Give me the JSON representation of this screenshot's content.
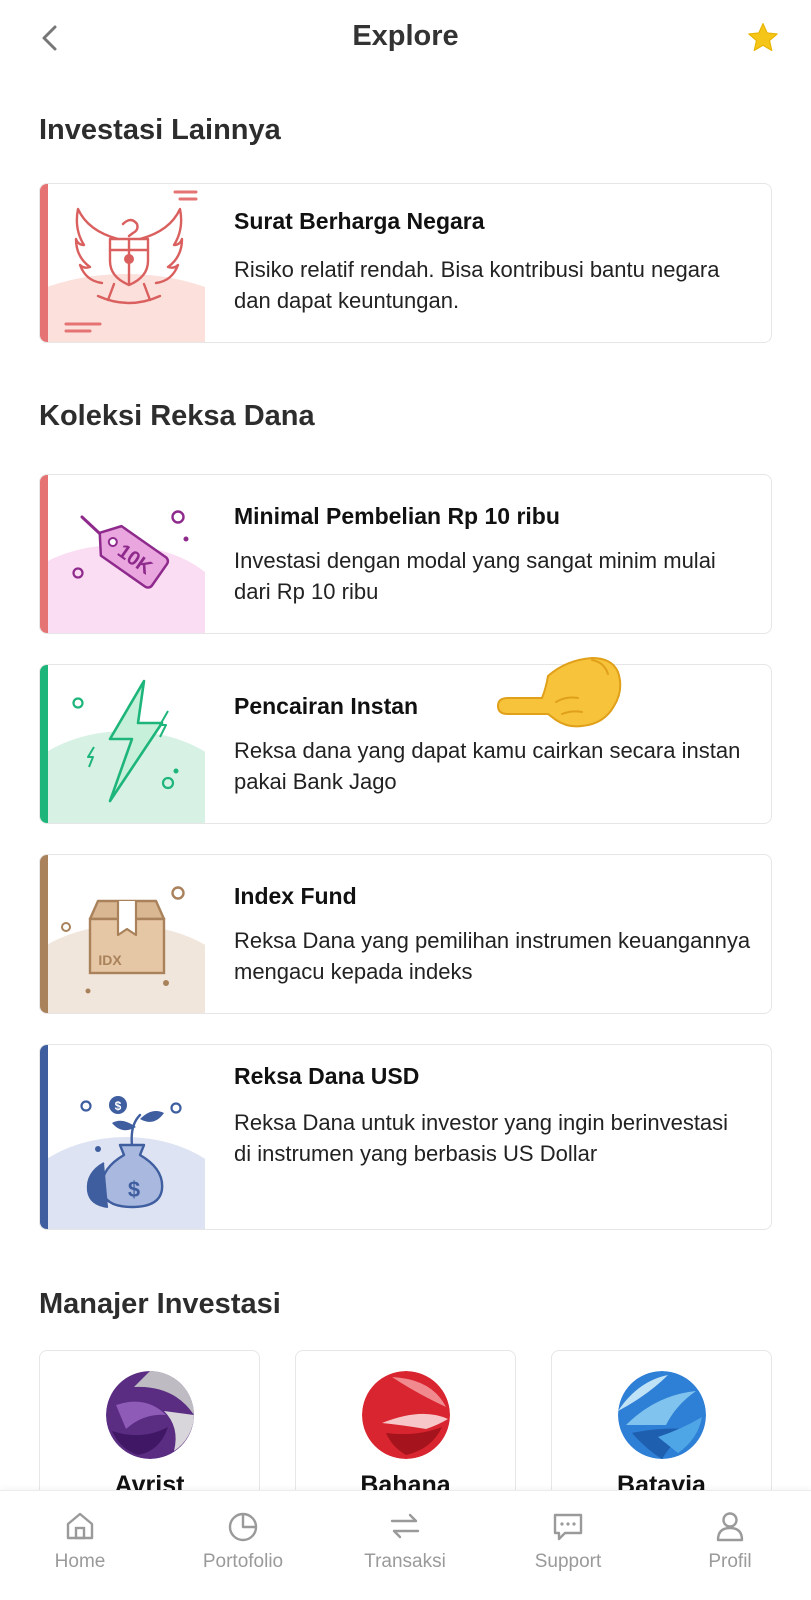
{
  "header": {
    "title": "Explore",
    "back_icon": "chevron-left-icon",
    "star_icon": "star-icon",
    "star_color": "#F5C518"
  },
  "sections": {
    "investasi_lainnya": "Investasi Lainnya",
    "koleksi_reksa_dana": "Koleksi Reksa Dana",
    "manajer_investasi": "Manajer Investasi"
  },
  "investasi_lainnya": {
    "sbn": {
      "title": "Surat Berharga Negara",
      "desc": "Risiko relatif rendah. Bisa kontribusi bantu negara dan dapat keuntungan.",
      "accent": "#E57373",
      "icon": "garuda-icon"
    }
  },
  "koleksi": {
    "minimal": {
      "title": "Minimal Pembelian Rp 10 ribu",
      "desc": "Investasi dengan modal yang sangat minim mulai dari Rp 10 ribu",
      "accent": "#E57373",
      "icon": "price-tag-icon",
      "tag_text": "10K"
    },
    "instan": {
      "title": "Pencairan Instan",
      "desc": "Reksa dana yang dapat kamu cairkan secara instan pakai Bank Jago",
      "accent": "#1DB57A",
      "icon": "lightning-icon"
    },
    "index": {
      "title": "Index Fund",
      "desc": "Reksa Dana yang pemilihan instrumen keuangannya mengacu kepada indeks",
      "accent": "#A9815A",
      "icon": "box-icon",
      "box_text": "IDX"
    },
    "usd": {
      "title": "Reksa Dana USD",
      "desc": "Reksa Dana untuk investor yang ingin berinvestasi di instrumen yang berbasis US Dollar",
      "accent": "#3F5EA0",
      "icon": "money-bag-icon",
      "coin_symbol": "$"
    }
  },
  "managers": [
    {
      "name": "Avrist",
      "logo": "avrist-logo"
    },
    {
      "name": "Bahana",
      "logo": "bahana-logo"
    },
    {
      "name": "Batavia",
      "logo": "batavia-logo"
    }
  ],
  "bottom_nav": [
    {
      "label": "Home",
      "icon": "home-icon"
    },
    {
      "label": "Portofolio",
      "icon": "pie-chart-icon"
    },
    {
      "label": "Transaksi",
      "icon": "transfer-arrows-icon"
    },
    {
      "label": "Support",
      "icon": "chat-bubble-icon"
    },
    {
      "label": "Profil",
      "icon": "user-icon"
    }
  ]
}
